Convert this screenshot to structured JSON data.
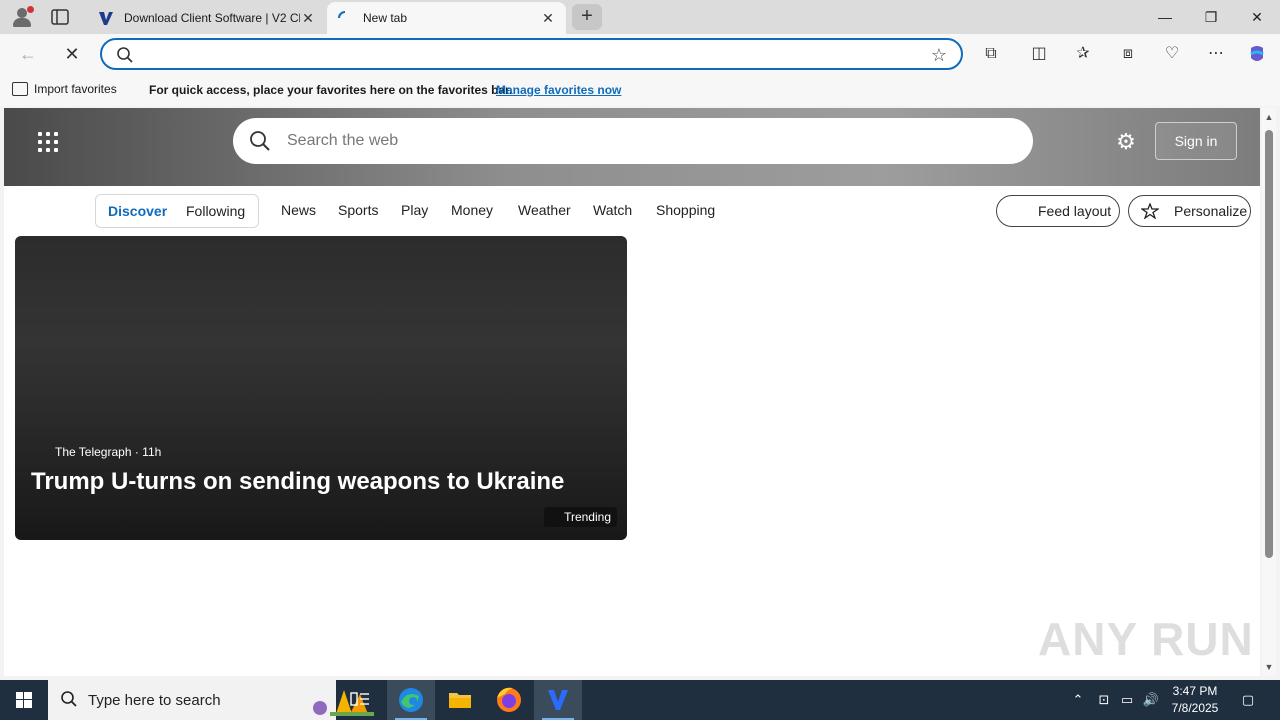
{
  "browser": {
    "tabs": [
      {
        "label": "Download Client Software | V2 Cl",
        "active": false
      },
      {
        "label": "New tab",
        "active": true
      }
    ],
    "new_tab_glyph": "+",
    "window_controls": {
      "minimize": "—",
      "maximize": "❐",
      "close": "✕"
    },
    "address_value": "",
    "favorites_bar": {
      "import_label": "Import favorites",
      "message": "For quick access, place your favorites here on the favorites bar.",
      "manage_link": "Manage favorites now"
    }
  },
  "newtab": {
    "search_placeholder": "Search the web",
    "sign_in": "Sign in",
    "segment_tabs": [
      "Discover",
      "Following"
    ],
    "nav_items": [
      "News",
      "Sports",
      "Play",
      "Money",
      "Weather",
      "Watch",
      "Shopping"
    ],
    "feed_layout": "Feed layout",
    "personalize": "Personalize",
    "card": {
      "source": "The Telegraph · 11h",
      "headline": "Trump U-turns on sending weapons to Ukraine",
      "badge": "Trending"
    },
    "watermark": "ANY RUN"
  },
  "taskbar": {
    "search_placeholder": "Type here to search",
    "time": "3:47 PM",
    "date": "7/8/2025"
  },
  "colors": {
    "accent": "#0f6cbd",
    "taskbar": "#1f2f3f"
  },
  "icons": [
    "profile-icon",
    "tab-actions-icon",
    "v2-favicon",
    "loading-icon",
    "back-icon",
    "stop-icon",
    "search-icon",
    "star-icon",
    "extensions-icon",
    "split-screen-icon",
    "favorites-icon",
    "collections-icon",
    "browser-essentials-icon",
    "more-icon",
    "copilot-icon",
    "apps-grid-icon",
    "gear-icon",
    "windows-start-icon",
    "task-view-icon",
    "edge-icon",
    "file-explorer-icon",
    "firefox-icon",
    "v2-app-icon"
  ]
}
